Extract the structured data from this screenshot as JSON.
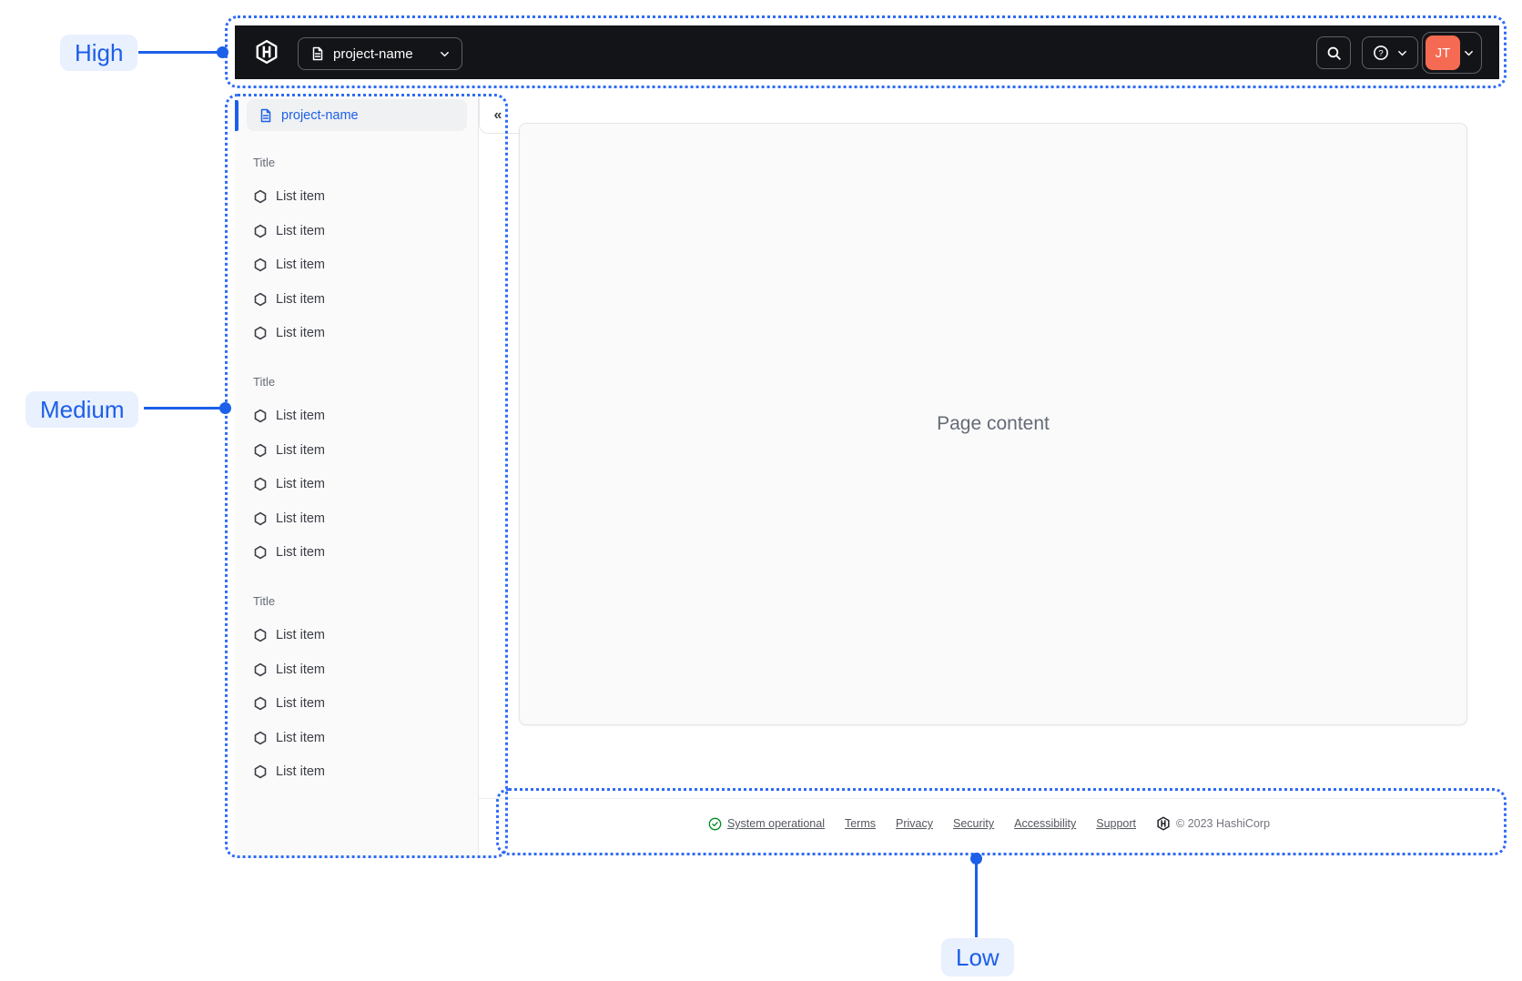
{
  "annotations": {
    "high_label": "High",
    "medium_label": "Medium",
    "low_label": "Low"
  },
  "navbar": {
    "project_switcher_label": "project-name"
  },
  "user": {
    "initials": "JT"
  },
  "sidebar": {
    "selected_project": "project-name",
    "collapse_glyph": "«",
    "sections": [
      {
        "title": "Title",
        "items": [
          "List item",
          "List item",
          "List item",
          "List item",
          "List item"
        ]
      },
      {
        "title": "Title",
        "items": [
          "List item",
          "List item",
          "List item",
          "List item",
          "List item"
        ]
      },
      {
        "title": "Title",
        "items": [
          "List item",
          "List item",
          "List item",
          "List item",
          "List item"
        ]
      }
    ]
  },
  "main": {
    "placeholder": "Page content"
  },
  "footer": {
    "status_label": "System operational",
    "links": [
      "Terms",
      "Privacy",
      "Security",
      "Accessibility",
      "Support"
    ],
    "copyright": "© 2023 HashiCorp"
  },
  "colors": {
    "accent_blue": "#1C5FE8",
    "zone_border_blue": "#2F6BF7",
    "label_bg_blue": "#E9F0FE",
    "navbar_bg": "#131418",
    "avatar_orange": "#F56A52",
    "success_green": "#008A22",
    "sidebar_bg": "#FAFAFB",
    "content_bg": "#FAFAFA"
  }
}
